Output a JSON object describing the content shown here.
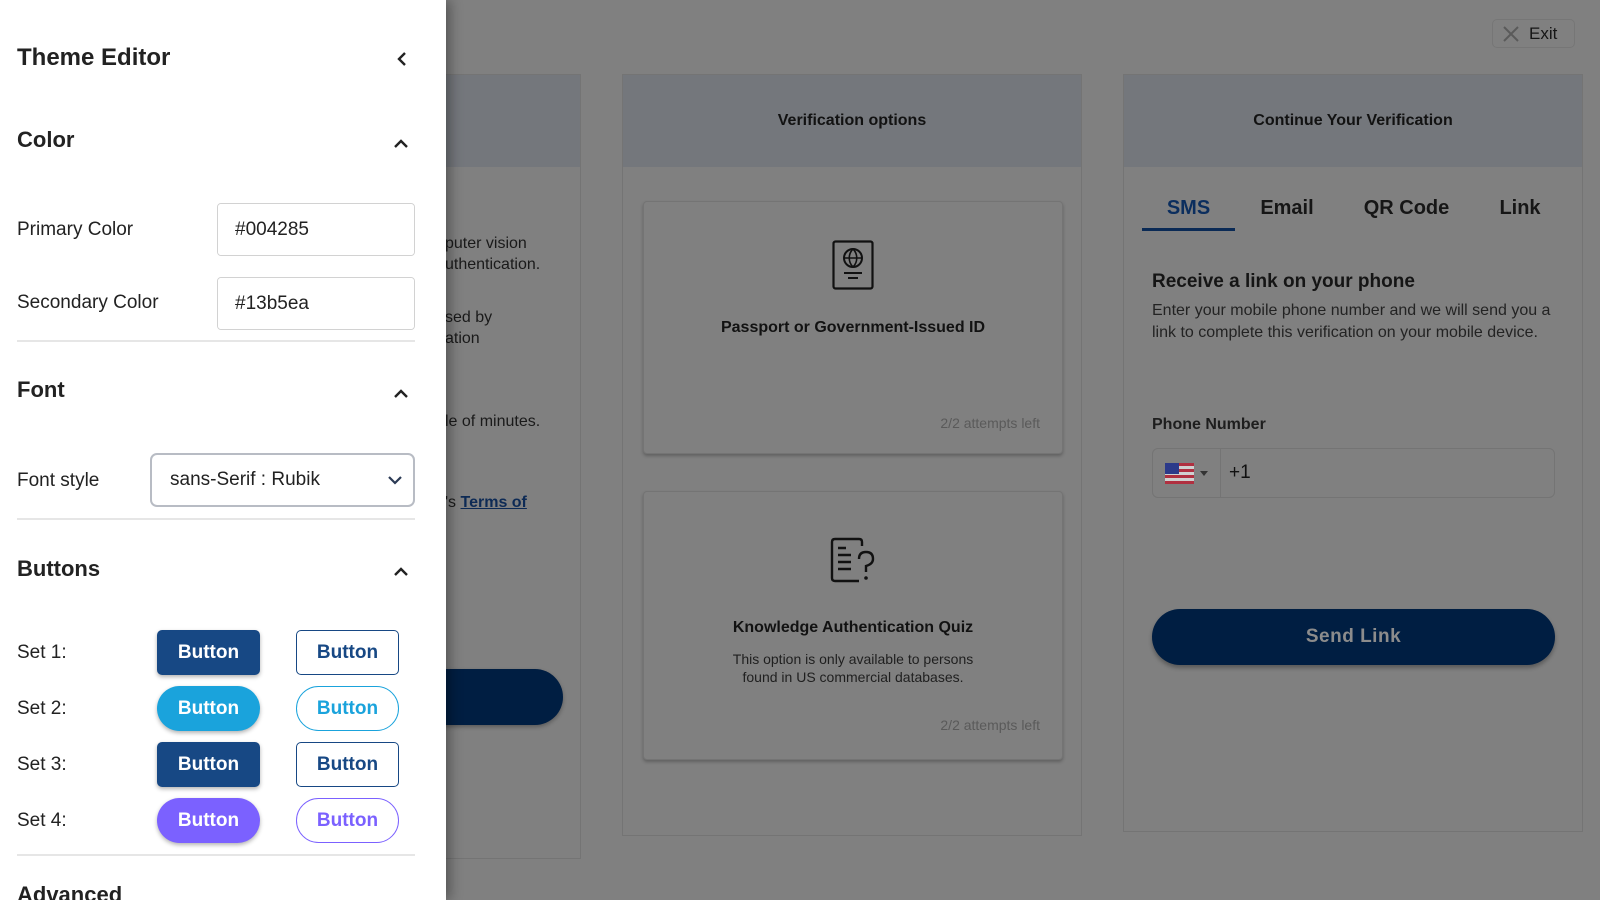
{
  "background": {
    "exit_label": "Exit",
    "card_about": {
      "lines": [
        "puter vision",
        "uthentication.",
        "",
        "",
        "sed by",
        "ation",
        "",
        "",
        "",
        "",
        "le of minutes."
      ],
      "text_a": "puter vision\nuthentication.",
      "text_b": "sed by\nation",
      "text_c": "le of minutes.",
      "terms_prefix": "'s ",
      "terms_link": "Terms of"
    },
    "card_options": {
      "title": "Verification options",
      "options": [
        {
          "icon": "passport-icon",
          "title": "Passport or Government-Issued ID",
          "description": "",
          "attempts": "2/2 attempts left"
        },
        {
          "icon": "quiz-document-icon",
          "title": "Knowledge Authentication Quiz",
          "description": "This option is only available to persons found in US commercial databases.",
          "attempts": "2/2 attempts left"
        }
      ]
    },
    "card_continue": {
      "title": "Continue Your Verification",
      "tabs": [
        {
          "label": "SMS",
          "active": true
        },
        {
          "label": "Email",
          "active": false
        },
        {
          "label": "QR Code",
          "active": false
        },
        {
          "label": "Link",
          "active": false
        }
      ],
      "heading": "Receive a link on your phone",
      "description": "Enter your mobile phone number and we will send you a link to complete this verification on your mobile device.",
      "phone_label": "Phone Number",
      "country": "US",
      "phone_value": "+1",
      "send_label": "Send Link"
    }
  },
  "sidebar": {
    "title": "Theme Editor",
    "sections": {
      "color": {
        "title": "Color",
        "primary_label": "Primary Color",
        "primary_value": "#004285",
        "secondary_label": "Secondary Color",
        "secondary_value": "#13b5ea"
      },
      "font": {
        "title": "Font",
        "style_label": "Font style",
        "style_value": "sans-Serif : Rubik"
      },
      "buttons": {
        "title": "Buttons",
        "sets": [
          {
            "label": "Set 1:",
            "button_label": "Button",
            "color": "#174884",
            "shape": "rounded"
          },
          {
            "label": "Set 2:",
            "button_label": "Button",
            "color": "#1aa3dc",
            "shape": "pill"
          },
          {
            "label": "Set 3:",
            "button_label": "Button",
            "color": "#174884",
            "shape": "rounded"
          },
          {
            "label": "Set 4:",
            "button_label": "Button",
            "color": "#7b61ff",
            "shape": "pill"
          }
        ]
      },
      "advanced": {
        "title": "Advanced"
      }
    }
  }
}
